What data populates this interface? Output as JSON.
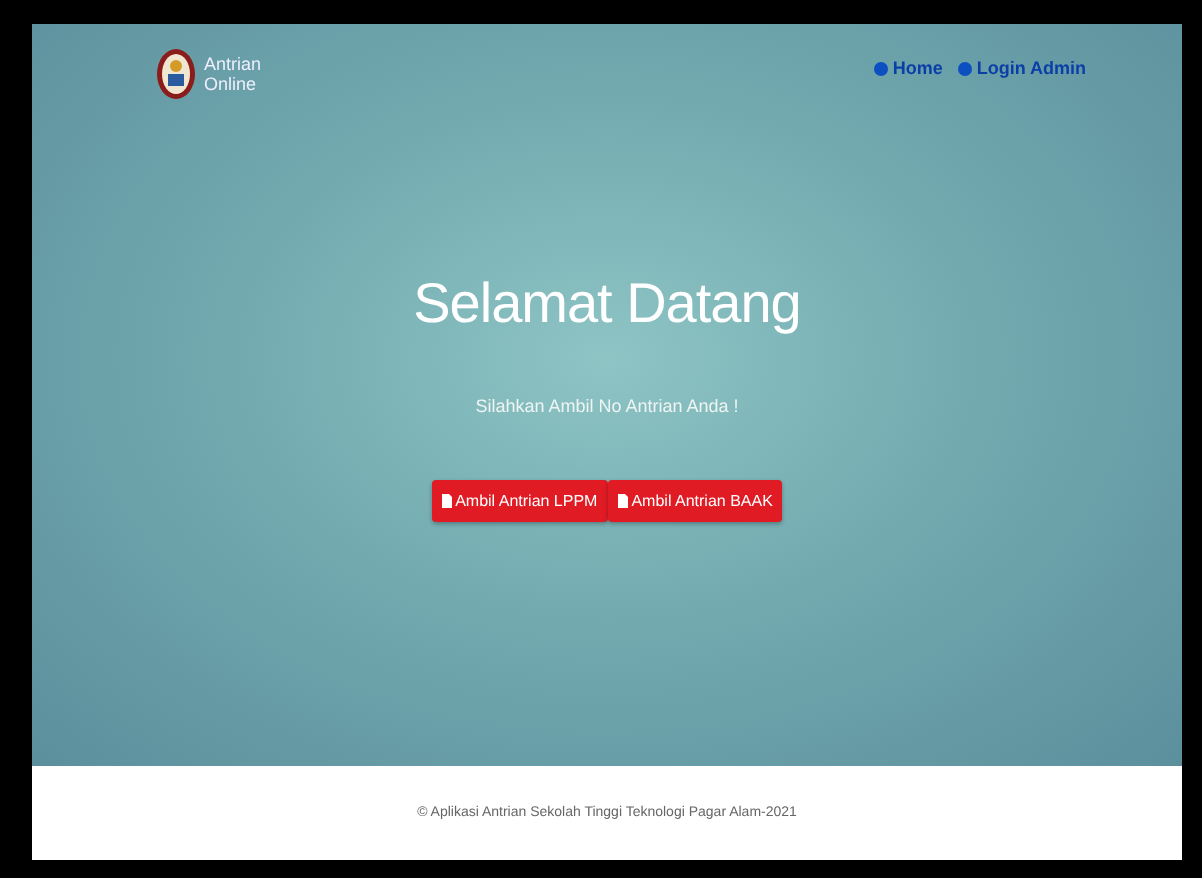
{
  "brand": {
    "line_1": "Antrian",
    "line_2": "Online"
  },
  "nav": [
    {
      "label": "Home"
    },
    {
      "label": "Login Admin"
    }
  ],
  "hero": {
    "title": "Selamat Datang",
    "subtitle": "Silahkan Ambil No Antrian Anda !",
    "buttons": [
      {
        "label": "Ambil Antrian LPPM"
      },
      {
        "label": "Ambil Antrian BAAK"
      }
    ]
  },
  "footer": "© Aplikasi Antrian Sekolah Tinggi Teknologi Pagar Alam-2021"
}
